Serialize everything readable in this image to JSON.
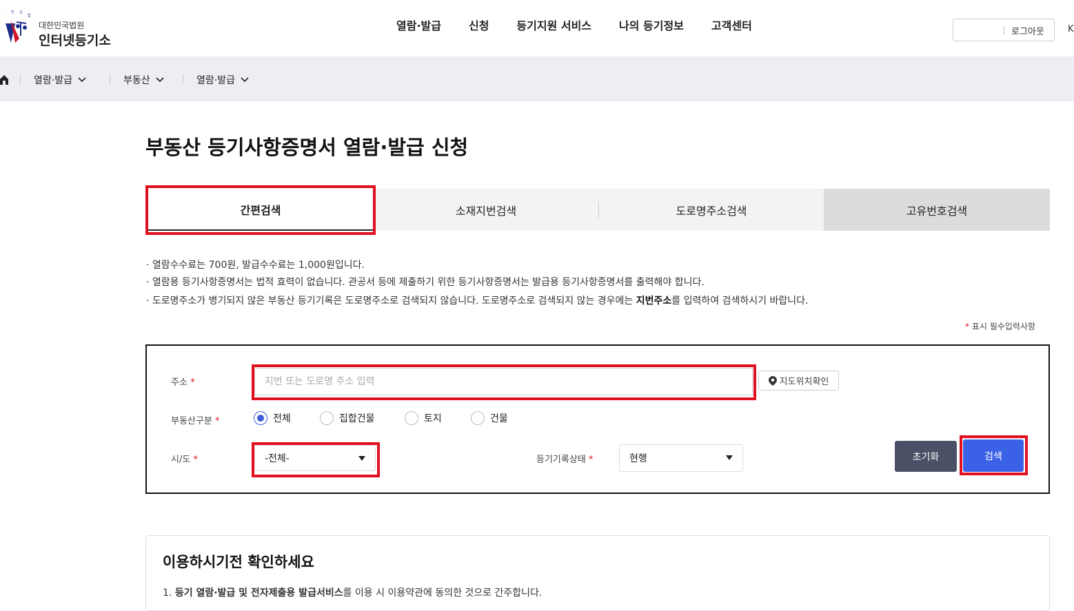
{
  "header": {
    "logo_sub": "대한민국법원",
    "logo_main": "인터넷등기소",
    "nav": [
      "열람·발급",
      "신청",
      "등기지원 서비스",
      "나의 등기정보",
      "고객센터"
    ],
    "logout": "로그아웃",
    "lang": "K"
  },
  "breadcrumb": [
    "열람·발급",
    "부동산",
    "열람·발급"
  ],
  "page_title": "부동산 등기사항증명서 열람·발급 신청",
  "tabs": [
    "간편검색",
    "소재지번검색",
    "도로명주소검색",
    "고유번호검색"
  ],
  "notices": {
    "n1": "· 열람수수료는  700원, 발급수수료는  1,000원입니다.",
    "n2": "· 열람용 등기사항증명서는 법적 효력이 없습니다. 관공서 등에 제출하기 위한 등기사항증명서는 발급용 등기사항증명서를 출력해야 합니다.",
    "n3_pre": "· 도로명주소가 병기되지 않은 부동산 등기기록은 도로명주소로 검색되지 않습니다. 도로명주소로 검색되지 않는 경우에는 ",
    "n3_bold": "지번주소",
    "n3_post": "를 입력하여 검색하시기 바랍니다."
  },
  "required_note": "표시 필수입력사항",
  "form": {
    "address_label": "주소",
    "address_placeholder": "지번 또는 도로명 주소 입력",
    "map_button": "지도위치확인",
    "type_label": "부동산구분",
    "type_options": [
      "전체",
      "집합건물",
      "토지",
      "건물"
    ],
    "type_selected": "전체",
    "sido_label": "시/도",
    "sido_value": "-전체-",
    "status_label": "등기기록상태",
    "status_value": "현행",
    "reset_button": "초기화",
    "search_button": "검색"
  },
  "guide": {
    "title": "이용하시기전 확인하세요",
    "line1_pre": "1. ",
    "line1_bold": "등기 열람·발급 및 전자제출용 발급서비스",
    "line1_post": "를 이용 시 이용약관에 동의한 것으로 간주합니다."
  },
  "colors": {
    "accent": "#3b62e6",
    "highlight": "#e0101e",
    "reset": "#4a5066"
  }
}
